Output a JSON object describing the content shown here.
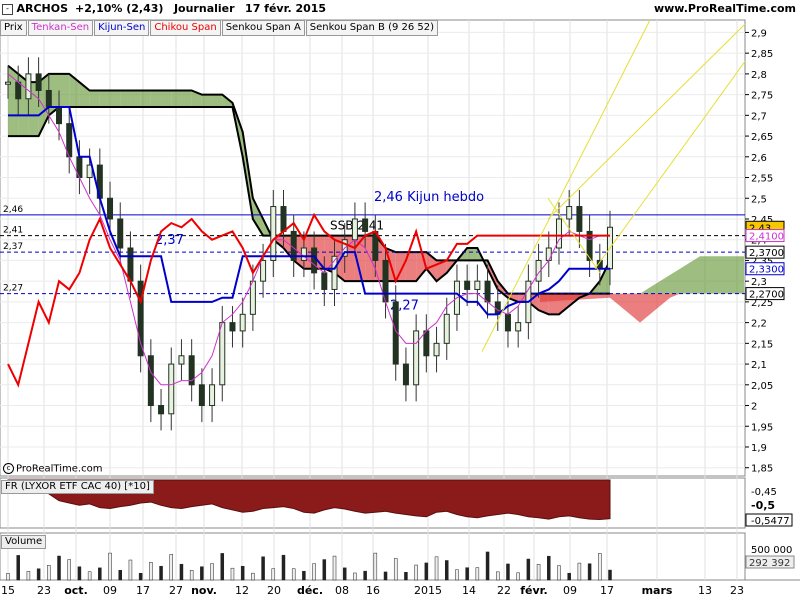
{
  "header": {
    "symbol": "ARCHOS",
    "change": "+2,10% (2,43)",
    "period": "Journalier",
    "date": "17 févr. 2015",
    "site": "www.ProRealTime.com"
  },
  "tabs": [
    {
      "label": "Prix",
      "color": "#000000"
    },
    {
      "label": "Tenkan-Sen",
      "color": "#cc33cc"
    },
    {
      "label": "Kijun-Sen",
      "color": "#0000cc"
    },
    {
      "label": "Chikou Span",
      "color": "#ee0000"
    },
    {
      "label": "Senkou Span A",
      "color": "#000000"
    },
    {
      "label": "Senkou Span B (9 26 52)",
      "color": "#000000"
    }
  ],
  "copyright": "ProRealTime.com",
  "fr_panel": {
    "label": "FR (LYXOR ETF CAC 40) [*10]",
    "ticks": [
      "-0,45",
      "-0,5",
      "-0,5477"
    ]
  },
  "volume_panel": {
    "label": "Volume",
    "ticks": [
      "500 000",
      "292 392"
    ]
  },
  "colors": {
    "bull_cloud": "#6a9a3c",
    "bear_cloud": "#e03a3a",
    "kijun": "#0000cc",
    "tenkan": "#cc33cc",
    "chikou": "#ee0000",
    "trendlines": "#e5e033",
    "fr_fill": "#8b1a1a"
  },
  "chart_data": {
    "type": "line",
    "title": "",
    "ylim": [
      1.83,
      2.93
    ],
    "y_ticks": [
      "2,9",
      "2,85",
      "2,8",
      "2,75",
      "2,7",
      "2,65",
      "2,6",
      "2,55",
      "2,5",
      "2,45",
      "2,4",
      "2,35",
      "2,3",
      "2,25",
      "2,2",
      "2,15",
      "2,1",
      "2,05",
      "2",
      "1,95",
      "1,9",
      "1,85"
    ],
    "x_ticks": [
      "15",
      "23",
      "oct.",
      "09",
      "17",
      "27",
      "nov.",
      "12",
      "20",
      "déc.",
      "08",
      "16",
      "2015",
      "14",
      "22",
      "févr.",
      "09",
      "17",
      "mars",
      "13",
      "23"
    ],
    "price_labels": [
      {
        "text": "2,43",
        "value": 2.43,
        "style": "last"
      },
      {
        "text": "2,4100",
        "value": 2.41,
        "style": "tenkan"
      },
      {
        "text": "2,3700",
        "value": 2.37,
        "style": "plain"
      },
      {
        "text": "2,3300",
        "value": 2.33,
        "style": "kijun"
      },
      {
        "text": "2,2700",
        "value": 2.27,
        "style": "plain"
      }
    ],
    "horizontal_levels": [
      {
        "value": 2.46,
        "left_label": "2,46",
        "text": "2,46 Kijun hebdo",
        "color": "#0000cc",
        "dash": "none"
      },
      {
        "value": 2.41,
        "left_label": "2,41",
        "text": "SSB 2,41",
        "color": "#000000",
        "dash": "4,3"
      },
      {
        "value": 2.37,
        "left_label": "2,37",
        "text": "2,37",
        "color": "#0000cc",
        "dash": "4,3"
      },
      {
        "value": 2.27,
        "left_label": "2,27",
        "text": "2,27",
        "color": "#0000cc",
        "dash": "4,3"
      }
    ],
    "series": [
      {
        "name": "Prix",
        "values": [
          2.78,
          2.74,
          2.8,
          2.76,
          2.72,
          2.68,
          2.6,
          2.55,
          2.58,
          2.5,
          2.45,
          2.38,
          2.3,
          2.12,
          2.0,
          1.98,
          2.1,
          2.12,
          2.05,
          2.0,
          2.05,
          2.2,
          2.18,
          2.22,
          2.3,
          2.35,
          2.48,
          2.42,
          2.35,
          2.38,
          2.32,
          2.28,
          2.36,
          2.4,
          2.45,
          2.42,
          2.35,
          2.25,
          2.1,
          2.05,
          2.18,
          2.12,
          2.15,
          2.22,
          2.3,
          2.28,
          2.3,
          2.25,
          2.22,
          2.18,
          2.2,
          2.3,
          2.35,
          2.38,
          2.45,
          2.48,
          2.42,
          2.35,
          2.33,
          2.43
        ]
      },
      {
        "name": "Tenkan-Sen",
        "values": [
          2.8,
          2.78,
          2.76,
          2.74,
          2.7,
          2.66,
          2.6,
          2.55,
          2.5,
          2.46,
          2.4,
          2.35,
          2.25,
          2.15,
          2.08,
          2.05,
          2.05,
          2.06,
          2.06,
          2.08,
          2.12,
          2.2,
          2.22,
          2.25,
          2.3,
          2.36,
          2.4,
          2.4,
          2.38,
          2.36,
          2.34,
          2.32,
          2.35,
          2.38,
          2.4,
          2.38,
          2.33,
          2.25,
          2.18,
          2.15,
          2.15,
          2.18,
          2.2,
          2.24,
          2.26,
          2.27,
          2.27,
          2.25,
          2.23,
          2.22,
          2.24,
          2.28,
          2.32,
          2.35,
          2.4,
          2.42,
          2.41,
          2.4,
          2.41,
          2.41
        ]
      },
      {
        "name": "Kijun-Sen",
        "values": [
          2.7,
          2.7,
          2.7,
          2.7,
          2.72,
          2.72,
          2.72,
          2.6,
          2.6,
          2.5,
          2.42,
          2.36,
          2.36,
          2.36,
          2.36,
          2.36,
          2.25,
          2.25,
          2.25,
          2.25,
          2.25,
          2.26,
          2.26,
          2.36,
          2.36,
          2.36,
          2.36,
          2.36,
          2.36,
          2.36,
          2.36,
          2.33,
          2.33,
          2.37,
          2.37,
          2.27,
          2.27,
          2.27,
          2.27,
          2.27,
          2.27,
          2.27,
          2.27,
          2.27,
          2.27,
          2.25,
          2.25,
          2.22,
          2.22,
          2.24,
          2.25,
          2.25,
          2.27,
          2.28,
          2.3,
          2.33,
          2.33,
          2.33,
          2.33,
          2.33
        ]
      },
      {
        "name": "Chikou Span",
        "values": [
          2.1,
          2.05,
          2.15,
          2.25,
          2.2,
          2.3,
          2.28,
          2.32,
          2.4,
          2.45,
          2.38,
          2.34,
          2.3,
          2.25,
          2.35,
          2.42,
          2.44,
          2.43,
          2.45,
          2.42,
          2.4,
          2.41,
          2.42,
          2.38,
          2.32,
          2.36,
          2.4,
          2.42,
          2.44,
          2.4,
          2.46,
          2.42,
          2.4,
          2.39,
          2.38,
          2.41,
          2.42,
          2.38,
          2.3,
          2.35,
          2.42,
          2.33,
          2.34,
          2.35,
          2.39,
          2.39,
          2.41,
          2.41,
          2.41,
          2.41,
          2.41,
          2.41,
          2.41,
          2.41,
          2.41,
          2.41,
          2.41,
          2.41,
          2.41,
          2.41
        ]
      },
      {
        "name": "Senkou Span A",
        "values": [
          2.82,
          2.8,
          2.78,
          2.78,
          2.8,
          2.8,
          2.8,
          2.78,
          2.76,
          2.76,
          2.76,
          2.76,
          2.76,
          2.76,
          2.76,
          2.76,
          2.76,
          2.76,
          2.76,
          2.75,
          2.75,
          2.75,
          2.73,
          2.66,
          2.5,
          2.45,
          2.4,
          2.38,
          2.35,
          2.33,
          2.33,
          2.33,
          2.32,
          2.3,
          2.3,
          2.3,
          2.3,
          2.3,
          2.3,
          2.3,
          2.3,
          2.33,
          2.3,
          2.32,
          2.35,
          2.38,
          2.38,
          2.33,
          2.28,
          2.26,
          2.25,
          2.25,
          2.23,
          2.22,
          2.22,
          2.24,
          2.26,
          2.27,
          2.3,
          2.35
        ]
      },
      {
        "name": "Senkou Span B",
        "values": [
          2.65,
          2.65,
          2.65,
          2.65,
          2.7,
          2.72,
          2.72,
          2.72,
          2.72,
          2.72,
          2.72,
          2.72,
          2.72,
          2.72,
          2.72,
          2.72,
          2.72,
          2.72,
          2.72,
          2.72,
          2.72,
          2.72,
          2.72,
          2.6,
          2.45,
          2.41,
          2.41,
          2.41,
          2.41,
          2.41,
          2.41,
          2.41,
          2.41,
          2.41,
          2.41,
          2.41,
          2.41,
          2.38,
          2.37,
          2.37,
          2.37,
          2.37,
          2.35,
          2.35,
          2.35,
          2.35,
          2.35,
          2.35,
          2.3,
          2.27,
          2.27,
          2.27,
          2.27,
          2.27,
          2.27,
          2.27,
          2.27,
          2.27,
          2.27,
          2.27
        ]
      }
    ]
  }
}
